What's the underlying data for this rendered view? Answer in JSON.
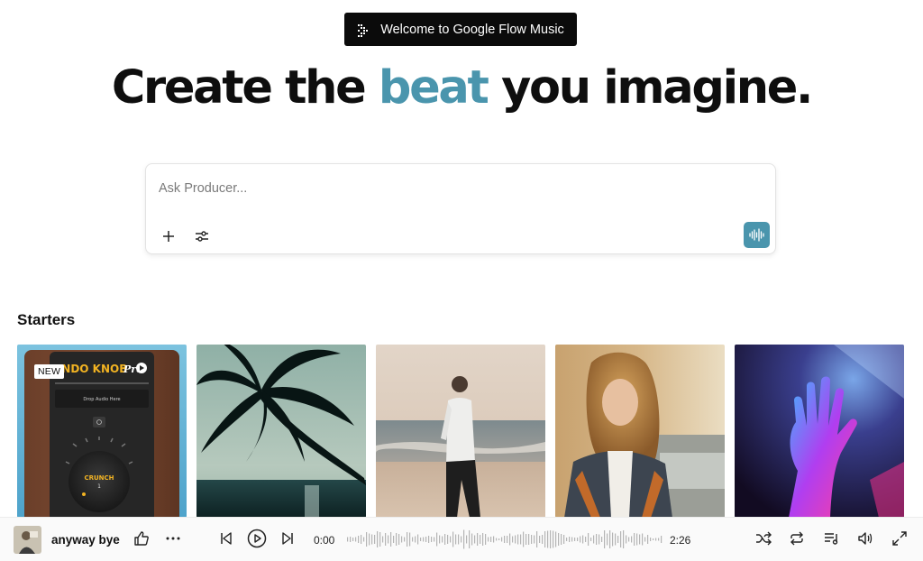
{
  "banner": {
    "label": "Welcome to Google Flow Music",
    "icon": "dotted-arrow-icon"
  },
  "hero": {
    "prefix": "Create the",
    "accent": "beat",
    "suffix": "you imagine.",
    "accent_color": "#4a95ad"
  },
  "prompt": {
    "placeholder": "Ask Producer...",
    "value": "",
    "add_icon": "plus-icon",
    "settings_icon": "sliders-icon",
    "voice_icon": "waveform-icon",
    "voice_color": "#4a95ad"
  },
  "starters": {
    "title": "Starters",
    "cards": [
      {
        "name": "knob-pro",
        "badge": "NEW",
        "art_text": "ANDO KNOB Pro",
        "sub_text": "Drop Audio Here",
        "knob_label": "CRUNCH",
        "knob_value": "1"
      },
      {
        "name": "palm-tree",
        "badge": ""
      },
      {
        "name": "beach-man",
        "badge": ""
      },
      {
        "name": "woman-car",
        "badge": ""
      },
      {
        "name": "neon-hand",
        "badge": ""
      }
    ]
  },
  "player": {
    "track_title": "anyway bye",
    "current_time": "0:00",
    "duration": "2:26",
    "icons": [
      "thumbs-up-icon",
      "more-icon",
      "skip-back-icon",
      "play-icon",
      "skip-forward-icon",
      "shuffle-icon",
      "repeat-icon",
      "queue-icon",
      "volume-icon",
      "expand-icon"
    ]
  }
}
